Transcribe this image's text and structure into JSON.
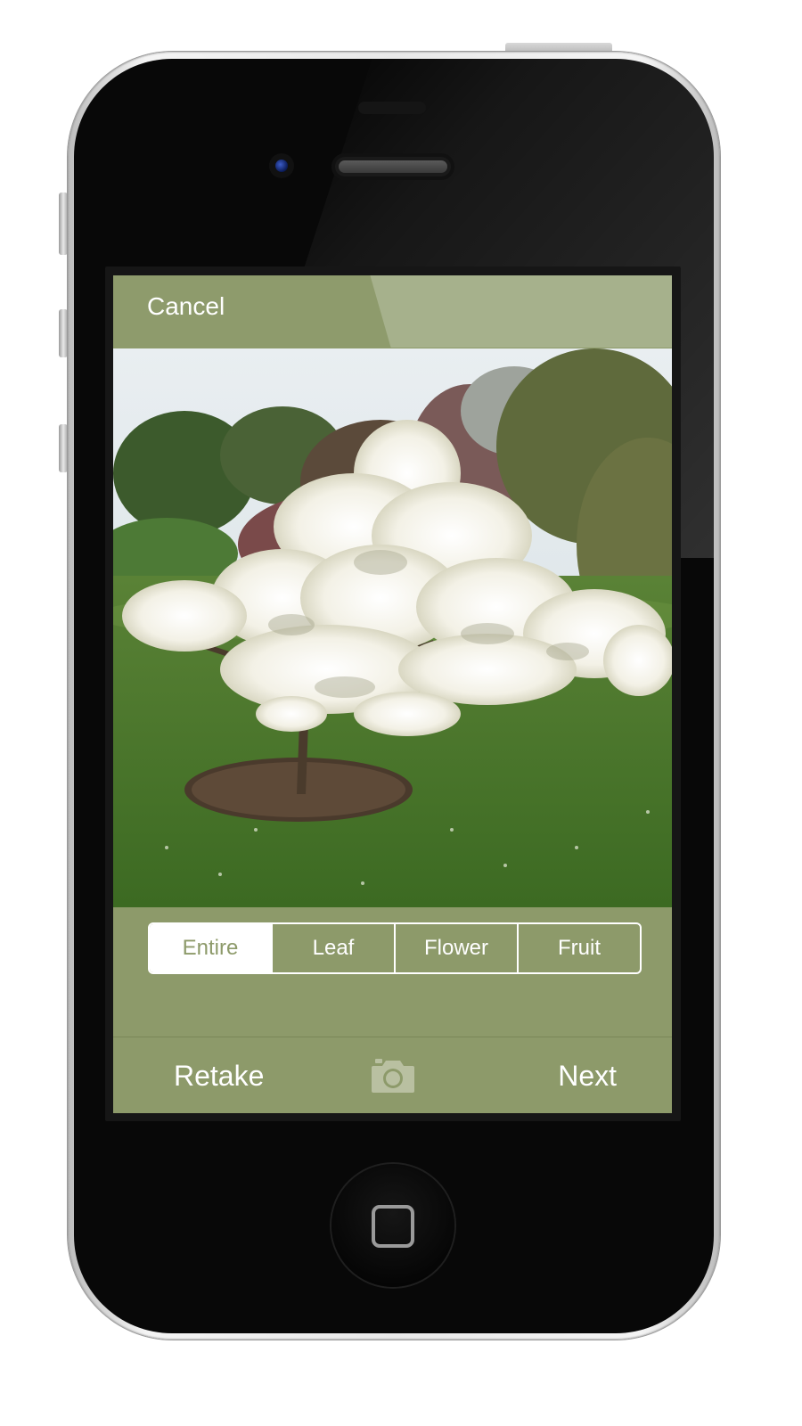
{
  "nav": {
    "cancel_label": "Cancel"
  },
  "photo": {
    "subject": "flowering-tree-photo"
  },
  "segments": [
    {
      "label": "Entire",
      "selected": true
    },
    {
      "label": "Leaf",
      "selected": false
    },
    {
      "label": "Flower",
      "selected": false
    },
    {
      "label": "Fruit",
      "selected": false
    }
  ],
  "toolbar": {
    "retake_label": "Retake",
    "next_label": "Next",
    "camera_icon": "camera-icon"
  },
  "colors": {
    "accent": "#8d9a6a",
    "text": "#ffffff",
    "phone_body": "#080808"
  }
}
